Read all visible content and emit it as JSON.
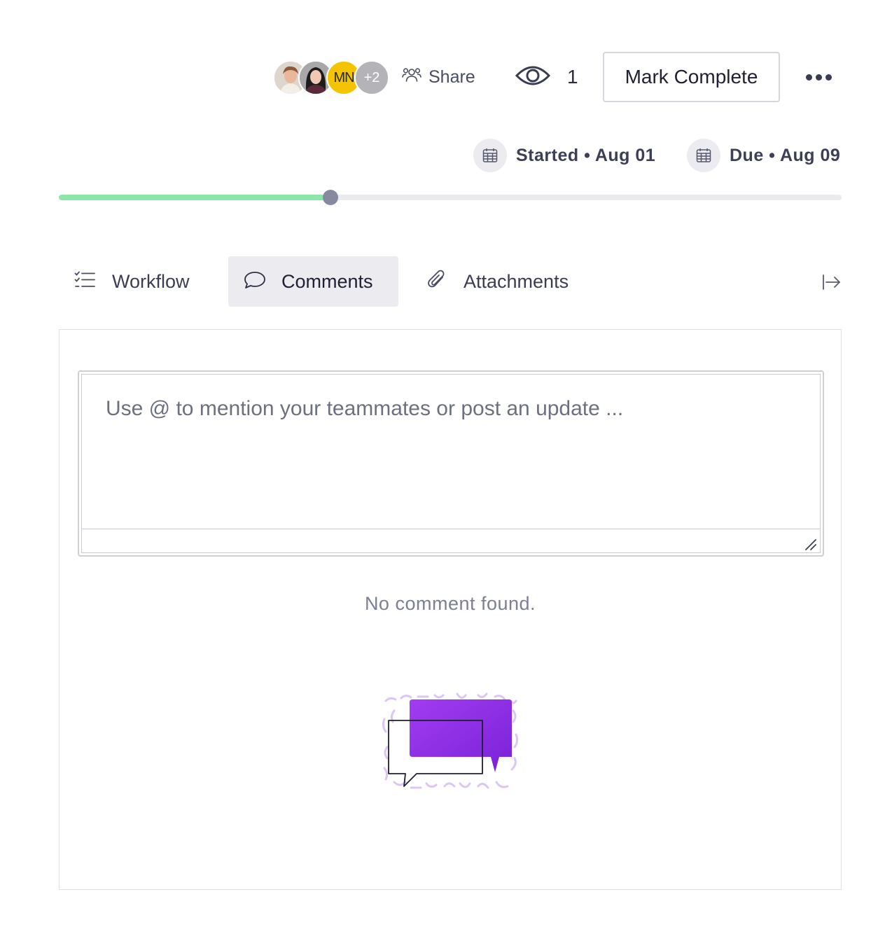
{
  "header": {
    "avatars": [
      {
        "name": "user-1",
        "initials": ""
      },
      {
        "name": "user-2",
        "initials": ""
      },
      {
        "name": "user-3",
        "initials": "MN"
      }
    ],
    "avatars_more": "+2",
    "share_label": "Share",
    "watch_count": "1",
    "mark_complete_label": "Mark Complete",
    "more_icon": "more-horizontal-icon"
  },
  "dates": {
    "started": "Started • Aug 01",
    "due": "Due • Aug 09",
    "icon": "calendar-icon"
  },
  "progress": {
    "fraction": 0.347,
    "fill_color": "#8be6a8",
    "knob_color": "#868aa0"
  },
  "tabs": [
    {
      "label": "Workflow",
      "icon": "checklist-icon",
      "active": false
    },
    {
      "label": "Comments",
      "icon": "speech-bubble-icon",
      "active": true
    },
    {
      "label": "Attachments",
      "icon": "paperclip-icon",
      "active": false
    }
  ],
  "comments": {
    "placeholder": "Use @ to mention your teammates or post an update ...",
    "value": "",
    "empty_text": "No comment found."
  },
  "colors": {
    "accent_purple": "#8a2be2",
    "active_tab_bg": "#ebebf0"
  }
}
